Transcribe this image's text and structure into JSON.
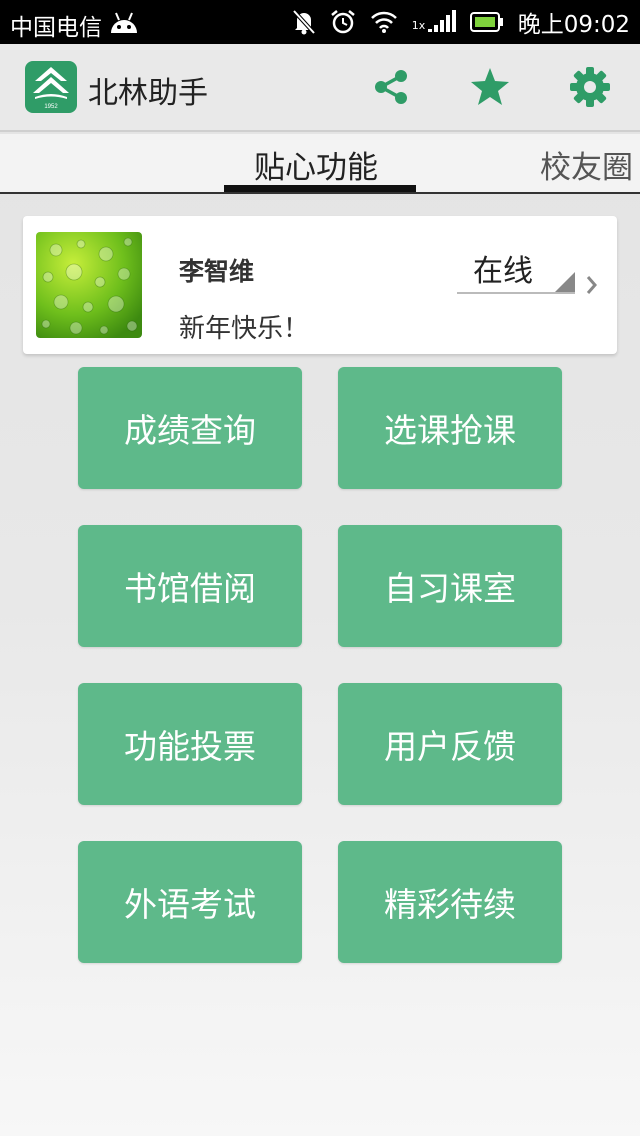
{
  "status_bar": {
    "carrier": "中国电信",
    "network": "1x",
    "time": "晚上09:02"
  },
  "action_bar": {
    "title": "北林助手",
    "logo_year": "1952",
    "icons": [
      "share-icon",
      "star-icon",
      "gear-icon"
    ],
    "accent": "#2f9c67"
  },
  "tabs": [
    {
      "label": "贴心功能",
      "active": true
    },
    {
      "label": "校友圈",
      "active": false
    }
  ],
  "profile": {
    "name": "李智维",
    "message": "新年快乐！",
    "status": "在线"
  },
  "tiles": [
    {
      "label": "成绩查询"
    },
    {
      "label": "选课抢课"
    },
    {
      "label": "书馆借阅"
    },
    {
      "label": "自习课室"
    },
    {
      "label": "功能投票"
    },
    {
      "label": "用户反馈"
    },
    {
      "label": "外语考试"
    },
    {
      "label": "精彩待续"
    }
  ],
  "colors": {
    "tile": "#5eb98a",
    "status_bar": "#000000",
    "action_bar": "#e9e9e9"
  }
}
